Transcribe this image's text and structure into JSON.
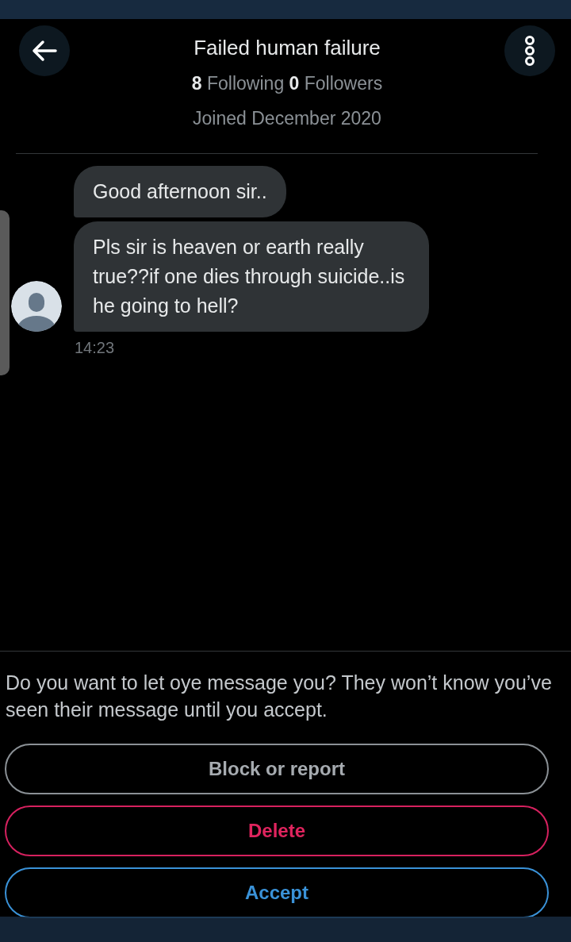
{
  "header": {
    "title": "Failed human failure",
    "stats": "**8** Following **0** Followers",
    "joined": "Joined December 2020"
  },
  "messages": [
    {
      "text": "Good afternoon sir.."
    },
    {
      "text": "Pls sir is heaven or earth really true??if one dies through suicide..is he going to hell?"
    }
  ],
  "message_time": "14:23",
  "request": {
    "prompt": "Do you want to let oye message you? They won’t know you’ve seen their message until you accept.",
    "buttons": [
      {
        "label": "Block or report",
        "kind": "neutral"
      },
      {
        "label": "Delete",
        "kind": "danger"
      },
      {
        "label": "Accept",
        "kind": "primary"
      }
    ]
  }
}
